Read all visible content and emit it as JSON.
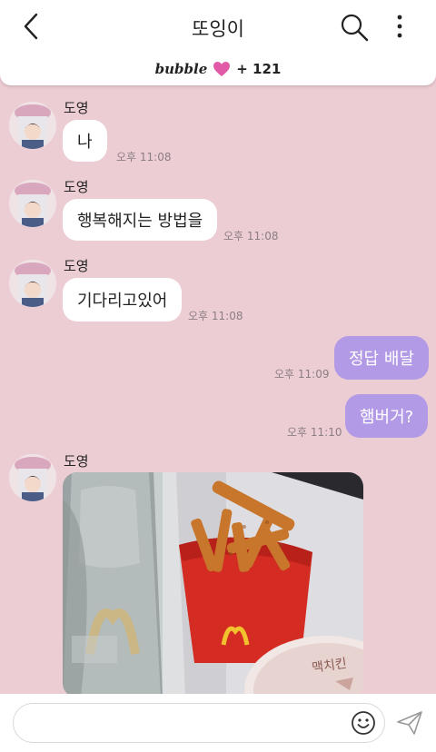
{
  "header": {
    "title": "또잉이"
  },
  "banner": {
    "word": "bubble",
    "count": "+ 121",
    "heart_color": "#e05aa8"
  },
  "messages": [
    {
      "sender": "도영",
      "text": "나",
      "time": "오후 11:08"
    },
    {
      "sender": "도영",
      "text": "행복해지는 방법을",
      "time": "오후 11:08"
    },
    {
      "sender": "도영",
      "text": "기다리고있어",
      "time": "오후 11:08"
    },
    {
      "text": "정답 배달",
      "time": "오후 11:09"
    },
    {
      "text": "햄버거?",
      "time": "오후 11:10"
    },
    {
      "sender": "도영"
    }
  ],
  "photo_logo": {
    "bag_text": "맥치킨"
  },
  "input": {
    "placeholder": ""
  },
  "colors": {
    "background": "#eccdd3",
    "outgoing_bubble": "#b39ae6",
    "incoming_bubble": "#ffffff"
  }
}
